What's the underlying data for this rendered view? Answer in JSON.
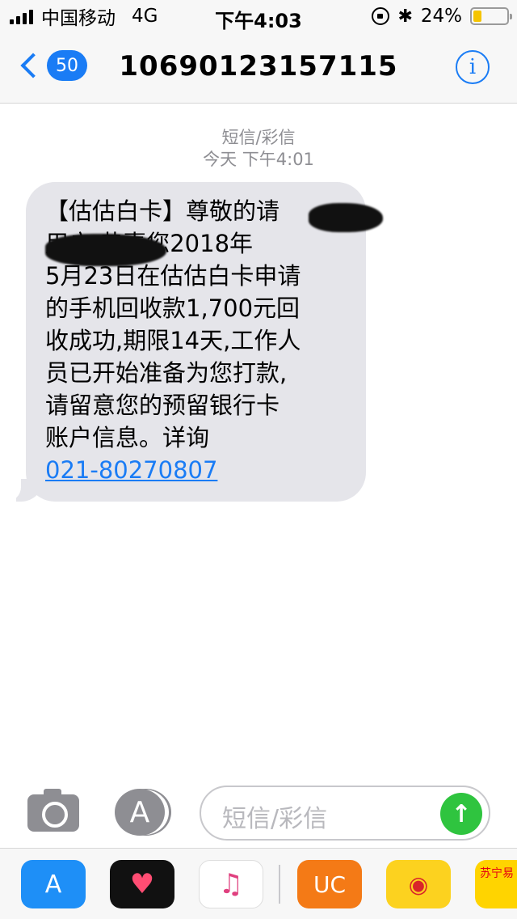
{
  "status_bar": {
    "carrier": "中国移动",
    "network": "4G",
    "time": "下午4:03",
    "battery_percent": "24%",
    "battery_level": 0.24,
    "icons": [
      "signal-icon",
      "rotation-lock-icon",
      "bluetooth-icon",
      "battery-icon"
    ]
  },
  "nav": {
    "back_count": "50",
    "title": "10690123157115",
    "info_glyph": "i"
  },
  "conversation": {
    "message_type": "短信/彩信",
    "date_label": "今天 下午4:01",
    "message": {
      "line1": "【估估白卡】尊敬的请",
      "line2": "用户,恭喜您2018年",
      "line3": "5月23日在估估白卡申请",
      "line4": "的手机回收款1,700元回",
      "line5": "收成功,期限14天,工作人",
      "line6": "员已开始准备为您打款,",
      "line7": "请留意您的预留银行卡",
      "line8": "账户信息。详询",
      "phone_link": "021-80270807"
    }
  },
  "input_bar": {
    "placeholder": "短信/彩信",
    "send_glyph": "↑",
    "store_glyph": "A"
  },
  "app_drawer": {
    "apps": [
      {
        "name": "App Store",
        "glyph": "A"
      },
      {
        "name": "Digital Touch",
        "glyph": "♥"
      },
      {
        "name": "Music",
        "glyph": "♫"
      },
      {
        "name": "UC",
        "glyph": "UC"
      },
      {
        "name": "Weibo",
        "glyph": "◉"
      },
      {
        "name": "苏宁易",
        "glyph": "苏宁易"
      }
    ],
    "colors": {
      "accent": "#1a7cf5",
      "send": "#2fc43f",
      "bubble": "#e5e5ea"
    }
  }
}
